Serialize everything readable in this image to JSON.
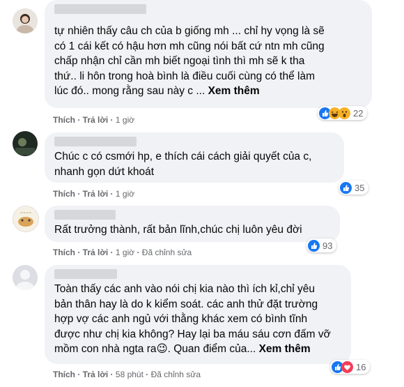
{
  "comments": [
    {
      "text": "tự nhiên thấy câu ch của b giống mh ... chỉ hy vọng là sẽ\ncó 1 cái kết có hậu hơn mh cũng nói bất cứ ntn mh cũng\nchấp nhận chỉ cần mh biết ngoại tình thì mh sẽ k tha\nthứ.. li hôn trong hoà bình là điều cuối cùng có thể làm\nlúc đó.. mong rằng sau này c ... ",
      "see_more": "Xem thêm",
      "like": "Thích",
      "reply": "Trả lời",
      "time": "1 giờ",
      "reactions": [
        "like-icon",
        "haha-icon",
        "wow-icon"
      ],
      "reaction_count": "22"
    },
    {
      "text": "Chúc c có csmới hp, e thích cái cách giải quyết của c,\nnhanh gọn dứt khoát",
      "like": "Thích",
      "reply": "Trả lời",
      "time": "1 giờ",
      "reactions": [
        "like-icon"
      ],
      "reaction_count": "35"
    },
    {
      "text": "Rất trưởng thành, rất bản lĩnh,chúc chị luôn yêu đời",
      "like": "Thích",
      "reply": "Trả lời",
      "time": "1 giờ",
      "edited": "Đã chỉnh sửa",
      "reactions": [
        "like-icon"
      ],
      "reaction_count": "93"
    },
    {
      "text": "Toàn thấy các anh vào nói chị kia nào thì ích kỉ,chỉ yêu\nbản thân hay là do k kiểm soát. các anh thử đặt trường\nhợp vợ các anh ngủ với thằng khác xem có bình tĩnh\nđược như chị kia không? Hay lại ba máu sáu cơn đấm vỡ\nmồm con nhà ngta ra😉. Quan điểm của... ",
      "see_more": "Xem thêm",
      "like": "Thích",
      "reply": "Trả lời",
      "time": "58 phút",
      "edited": "Đã chỉnh sửa",
      "reactions": [
        "like-icon",
        "love-icon"
      ],
      "reaction_count": "16"
    }
  ],
  "colors": {
    "like": "#1877f2",
    "love": "#f33e58",
    "haha": "#f7b125"
  }
}
